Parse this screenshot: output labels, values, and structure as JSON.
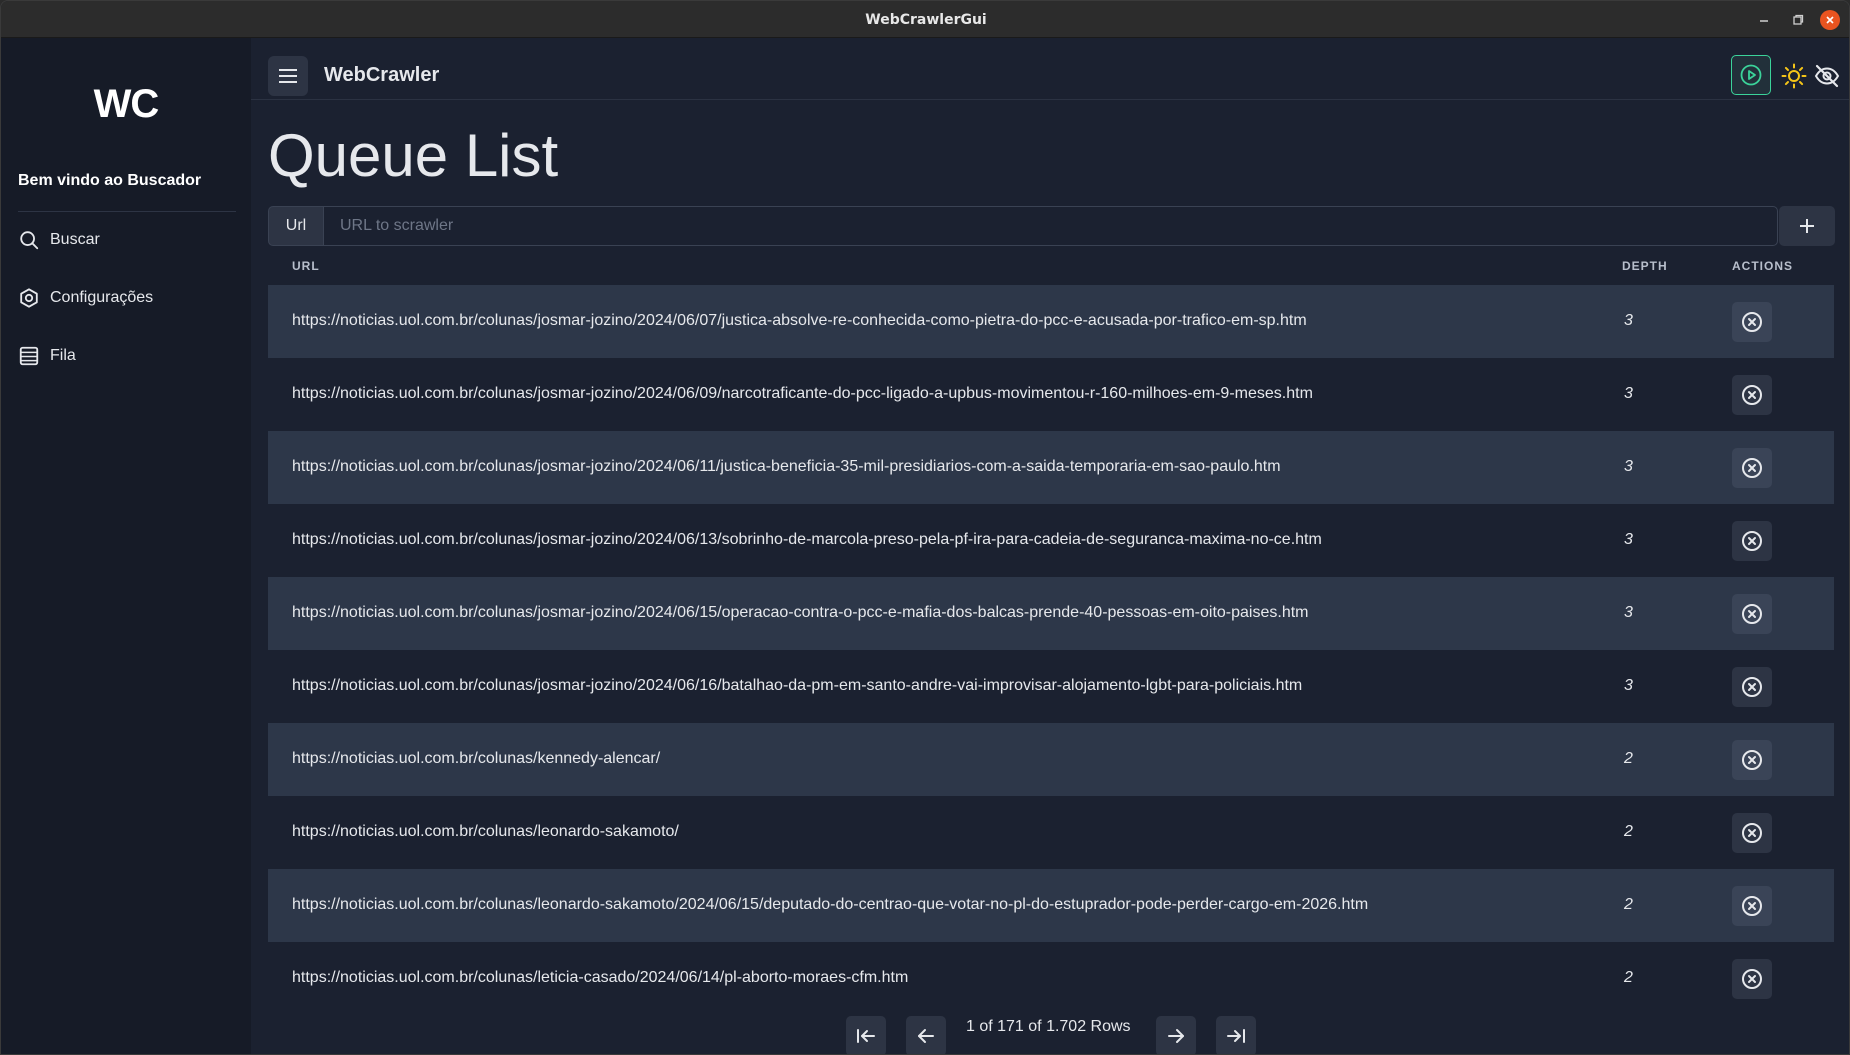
{
  "window": {
    "title": "WebCrawlerGui"
  },
  "sidebar": {
    "logo": "WC",
    "welcome": "Bem vindo ao Buscador",
    "items": [
      {
        "label": "Buscar",
        "icon": "search-icon"
      },
      {
        "label": "Configurações",
        "icon": "settings-icon"
      },
      {
        "label": "Fila",
        "icon": "list-icon"
      }
    ]
  },
  "header": {
    "app_title": "WebCrawler",
    "actions": [
      "play-circle-icon",
      "sun-icon",
      "eye-off-icon"
    ],
    "accent_color": "#3bd39a",
    "sun_color": "#f5c518"
  },
  "page": {
    "title": "Queue List",
    "url_addon": "Url",
    "url_placeholder": "URL to scrawler",
    "url_value": ""
  },
  "table": {
    "headers": {
      "url": "URL",
      "depth": "DEPTH",
      "actions": "ACTIONS"
    },
    "rows": [
      {
        "url": "https://noticias.uol.com.br/colunas/josmar-jozino/2024/06/07/justica-absolve-re-conhecida-como-pietra-do-pcc-e-acusada-por-trafico-em-sp.htm",
        "depth": "3"
      },
      {
        "url": "https://noticias.uol.com.br/colunas/josmar-jozino/2024/06/09/narcotraficante-do-pcc-ligado-a-upbus-movimentou-r-160-milhoes-em-9-meses.htm",
        "depth": "3"
      },
      {
        "url": "https://noticias.uol.com.br/colunas/josmar-jozino/2024/06/11/justica-beneficia-35-mil-presidiarios-com-a-saida-temporaria-em-sao-paulo.htm",
        "depth": "3"
      },
      {
        "url": "https://noticias.uol.com.br/colunas/josmar-jozino/2024/06/13/sobrinho-de-marcola-preso-pela-pf-ira-para-cadeia-de-seguranca-maxima-no-ce.htm",
        "depth": "3"
      },
      {
        "url": "https://noticias.uol.com.br/colunas/josmar-jozino/2024/06/15/operacao-contra-o-pcc-e-mafia-dos-balcas-prende-40-pessoas-em-oito-paises.htm",
        "depth": "3"
      },
      {
        "url": "https://noticias.uol.com.br/colunas/josmar-jozino/2024/06/16/batalhao-da-pm-em-santo-andre-vai-improvisar-alojamento-lgbt-para-policiais.htm",
        "depth": "3"
      },
      {
        "url": "https://noticias.uol.com.br/colunas/kennedy-alencar/",
        "depth": "2"
      },
      {
        "url": "https://noticias.uol.com.br/colunas/leonardo-sakamoto/",
        "depth": "2"
      },
      {
        "url": "https://noticias.uol.com.br/colunas/leonardo-sakamoto/2024/06/15/deputado-do-centrao-que-votar-no-pl-do-estuprador-pode-perder-cargo-em-2026.htm",
        "depth": "2"
      },
      {
        "url": "https://noticias.uol.com.br/colunas/leticia-casado/2024/06/14/pl-aborto-moraes-cfm.htm",
        "depth": "2"
      }
    ]
  },
  "pagination": {
    "info": "1 of 171 of 1.702 Rows"
  }
}
